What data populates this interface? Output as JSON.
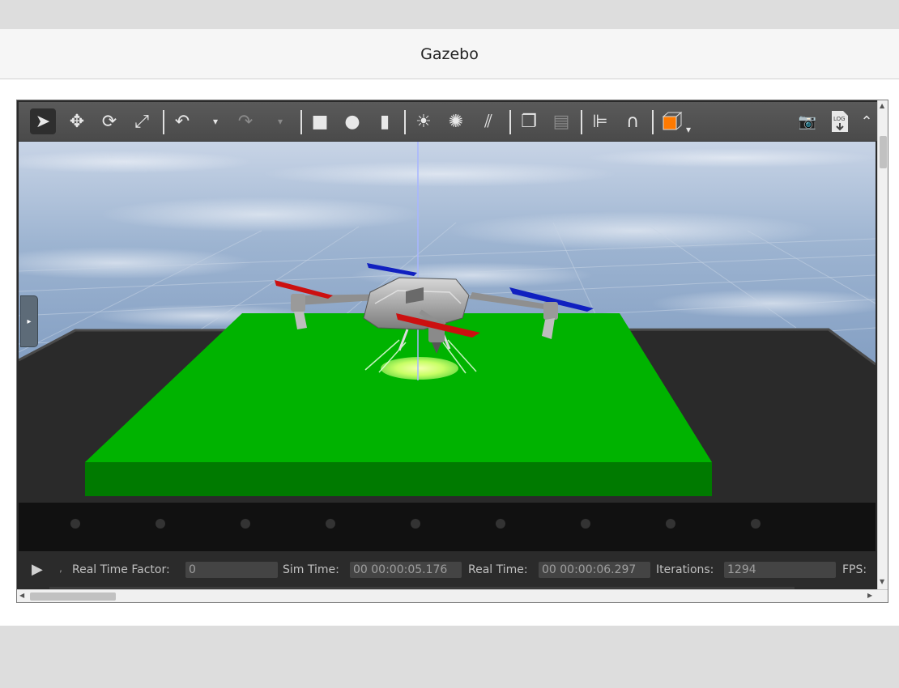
{
  "window": {
    "title": "Gazebo"
  },
  "toolbar": {
    "tools": [
      {
        "name": "select-tool",
        "glyph": "➤"
      },
      {
        "name": "translate-tool",
        "glyph": "✥"
      },
      {
        "name": "rotate-tool",
        "glyph": "⟳"
      },
      {
        "name": "scale-tool",
        "glyph": "⤢"
      },
      {
        "name": "undo-button",
        "glyph": "↶"
      },
      {
        "name": "redo-button",
        "glyph": "↷"
      },
      {
        "name": "box-shape-button",
        "glyph": "■"
      },
      {
        "name": "sphere-shape-button",
        "glyph": "●"
      },
      {
        "name": "cylinder-shape-button",
        "glyph": "▮"
      },
      {
        "name": "point-light-button",
        "glyph": "☀"
      },
      {
        "name": "spot-light-button",
        "glyph": "✺"
      },
      {
        "name": "directional-light-button",
        "glyph": "⫽"
      },
      {
        "name": "copy-button",
        "glyph": "❐"
      },
      {
        "name": "paste-button",
        "glyph": "▤"
      },
      {
        "name": "align-button",
        "glyph": "⊫"
      },
      {
        "name": "snap-button",
        "glyph": "∩"
      },
      {
        "name": "change-view-button",
        "glyph": "◧"
      },
      {
        "name": "screenshot-button",
        "glyph": "📷"
      },
      {
        "name": "log-button",
        "glyph": "🗎"
      }
    ],
    "log_label": "LOG",
    "accent_orange": "#ff7a00"
  },
  "left_panel_handle": {
    "glyph": "▸"
  },
  "status": {
    "play_glyph": "▶",
    "tick_glyph": "‚",
    "real_time_factor_label": "Real Time Factor:",
    "real_time_factor_value": "0",
    "sim_time_label": "Sim Time:",
    "sim_time_value": "00 00:00:05.176",
    "real_time_label": "Real Time:",
    "real_time_value": "00 00:00:06.297",
    "iterations_label": "Iterations:",
    "iterations_value": "1294",
    "fps_label": "FPS:"
  },
  "scene": {
    "pad_color": "#00b300",
    "pad_side_color": "#007a00",
    "prop_red": "#cc1010",
    "prop_blue": "#1020c0",
    "sky_color": "#8ba6c8"
  }
}
